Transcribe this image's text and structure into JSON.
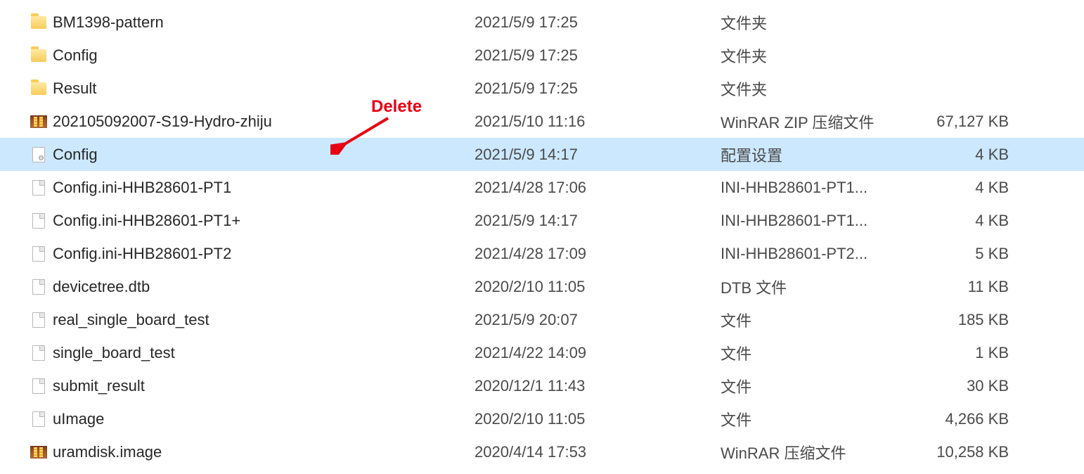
{
  "annotation": {
    "label": "Delete"
  },
  "files": [
    {
      "name": "BM1398-pattern",
      "date": "2021/5/9 17:25",
      "type": "文件夹",
      "size": "",
      "icon": "folder",
      "selected": false
    },
    {
      "name": "Config",
      "date": "2021/5/9 17:25",
      "type": "文件夹",
      "size": "",
      "icon": "folder",
      "selected": false
    },
    {
      "name": "Result",
      "date": "2021/5/9 17:25",
      "type": "文件夹",
      "size": "",
      "icon": "folder",
      "selected": false
    },
    {
      "name": "202105092007-S19-Hydro-zhiju",
      "date": "2021/5/10 11:16",
      "type": "WinRAR ZIP 压缩文件",
      "size": "67,127 KB",
      "icon": "archive",
      "selected": false
    },
    {
      "name": "Config",
      "date": "2021/5/9 14:17",
      "type": "配置设置",
      "size": "4 KB",
      "icon": "config",
      "selected": true
    },
    {
      "name": "Config.ini-HHB28601-PT1",
      "date": "2021/4/28 17:06",
      "type": "INI-HHB28601-PT1...",
      "size": "4 KB",
      "icon": "file",
      "selected": false
    },
    {
      "name": "Config.ini-HHB28601-PT1+",
      "date": "2021/5/9 14:17",
      "type": "INI-HHB28601-PT1...",
      "size": "4 KB",
      "icon": "file",
      "selected": false
    },
    {
      "name": "Config.ini-HHB28601-PT2",
      "date": "2021/4/28 17:09",
      "type": "INI-HHB28601-PT2...",
      "size": "5 KB",
      "icon": "file",
      "selected": false
    },
    {
      "name": "devicetree.dtb",
      "date": "2020/2/10 11:05",
      "type": "DTB 文件",
      "size": "11 KB",
      "icon": "file",
      "selected": false
    },
    {
      "name": "real_single_board_test",
      "date": "2021/5/9 20:07",
      "type": "文件",
      "size": "185 KB",
      "icon": "file",
      "selected": false
    },
    {
      "name": "single_board_test",
      "date": "2021/4/22 14:09",
      "type": "文件",
      "size": "1 KB",
      "icon": "file",
      "selected": false
    },
    {
      "name": "submit_result",
      "date": "2020/12/1 11:43",
      "type": "文件",
      "size": "30 KB",
      "icon": "file",
      "selected": false
    },
    {
      "name": "uImage",
      "date": "2020/2/10 11:05",
      "type": "文件",
      "size": "4,266 KB",
      "icon": "file",
      "selected": false
    },
    {
      "name": "uramdisk.image",
      "date": "2020/4/14 17:53",
      "type": "WinRAR 压缩文件",
      "size": "10,258 KB",
      "icon": "archive",
      "selected": false
    }
  ]
}
